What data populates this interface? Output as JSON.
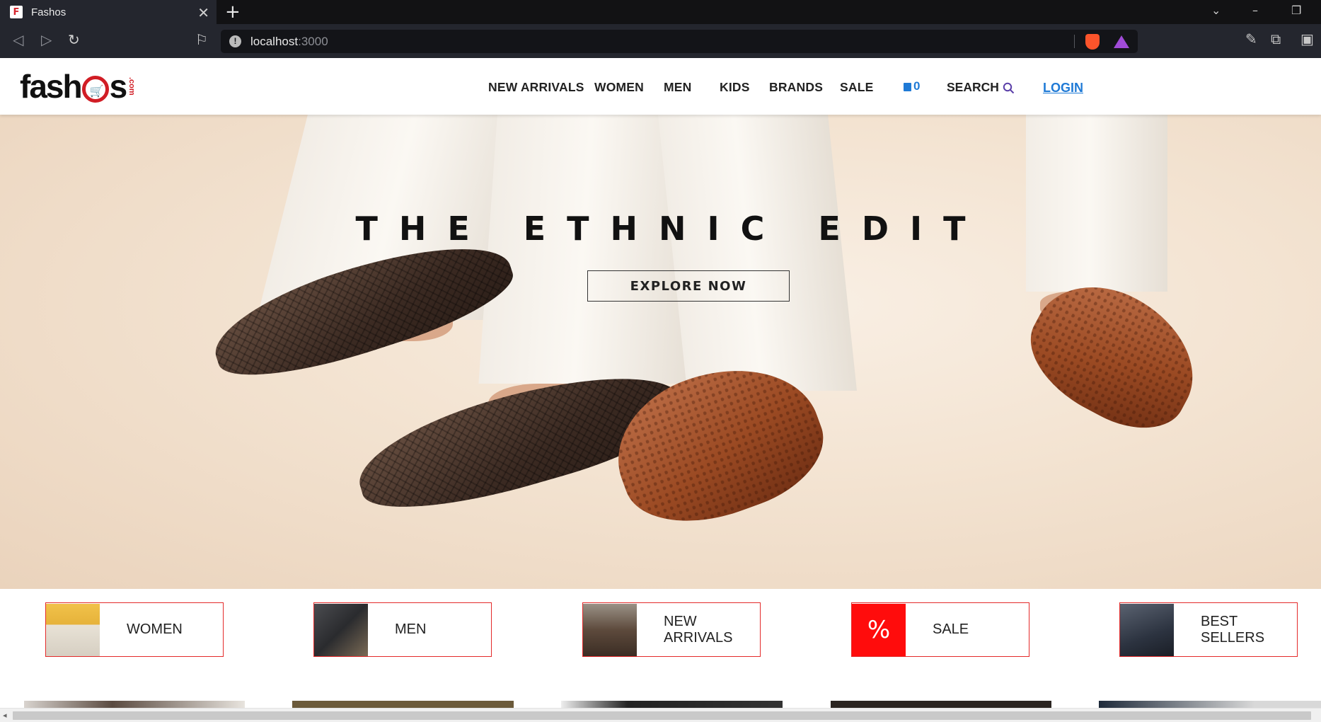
{
  "browser": {
    "tab_title": "Fashos",
    "tab_favicon_letter": "F",
    "url_host": "localhost",
    "url_port": ":3000"
  },
  "header": {
    "logo": "fashos",
    "logo_domain": ".com",
    "nav": [
      "NEW ARRIVALS",
      "WOMEN",
      "MEN",
      "KIDS",
      "BRANDS",
      "SALE"
    ],
    "cart_count": "0",
    "search_label": "SEARCH",
    "login_label": "LOGIN"
  },
  "hero": {
    "title": "THE ETHNIC EDIT",
    "cta_label": "EXPLORE NOW"
  },
  "categories": [
    {
      "label": "WOMEN",
      "thumb": "women-shoes-photo"
    },
    {
      "label": "MEN",
      "thumb": "men-fashion-photo"
    },
    {
      "label": "NEW ARRIVALS",
      "thumb": "boots-photo"
    },
    {
      "label": "SALE",
      "thumb": "percent-icon",
      "thumb_text": "%"
    },
    {
      "label": "BEST SELLERS",
      "thumb": "sneakers-photo"
    }
  ],
  "colors": {
    "accent_blue": "#1f7ad6",
    "brand_red": "#d11d25",
    "category_border": "#e42a2a",
    "sale_red": "#ff0c0c"
  }
}
